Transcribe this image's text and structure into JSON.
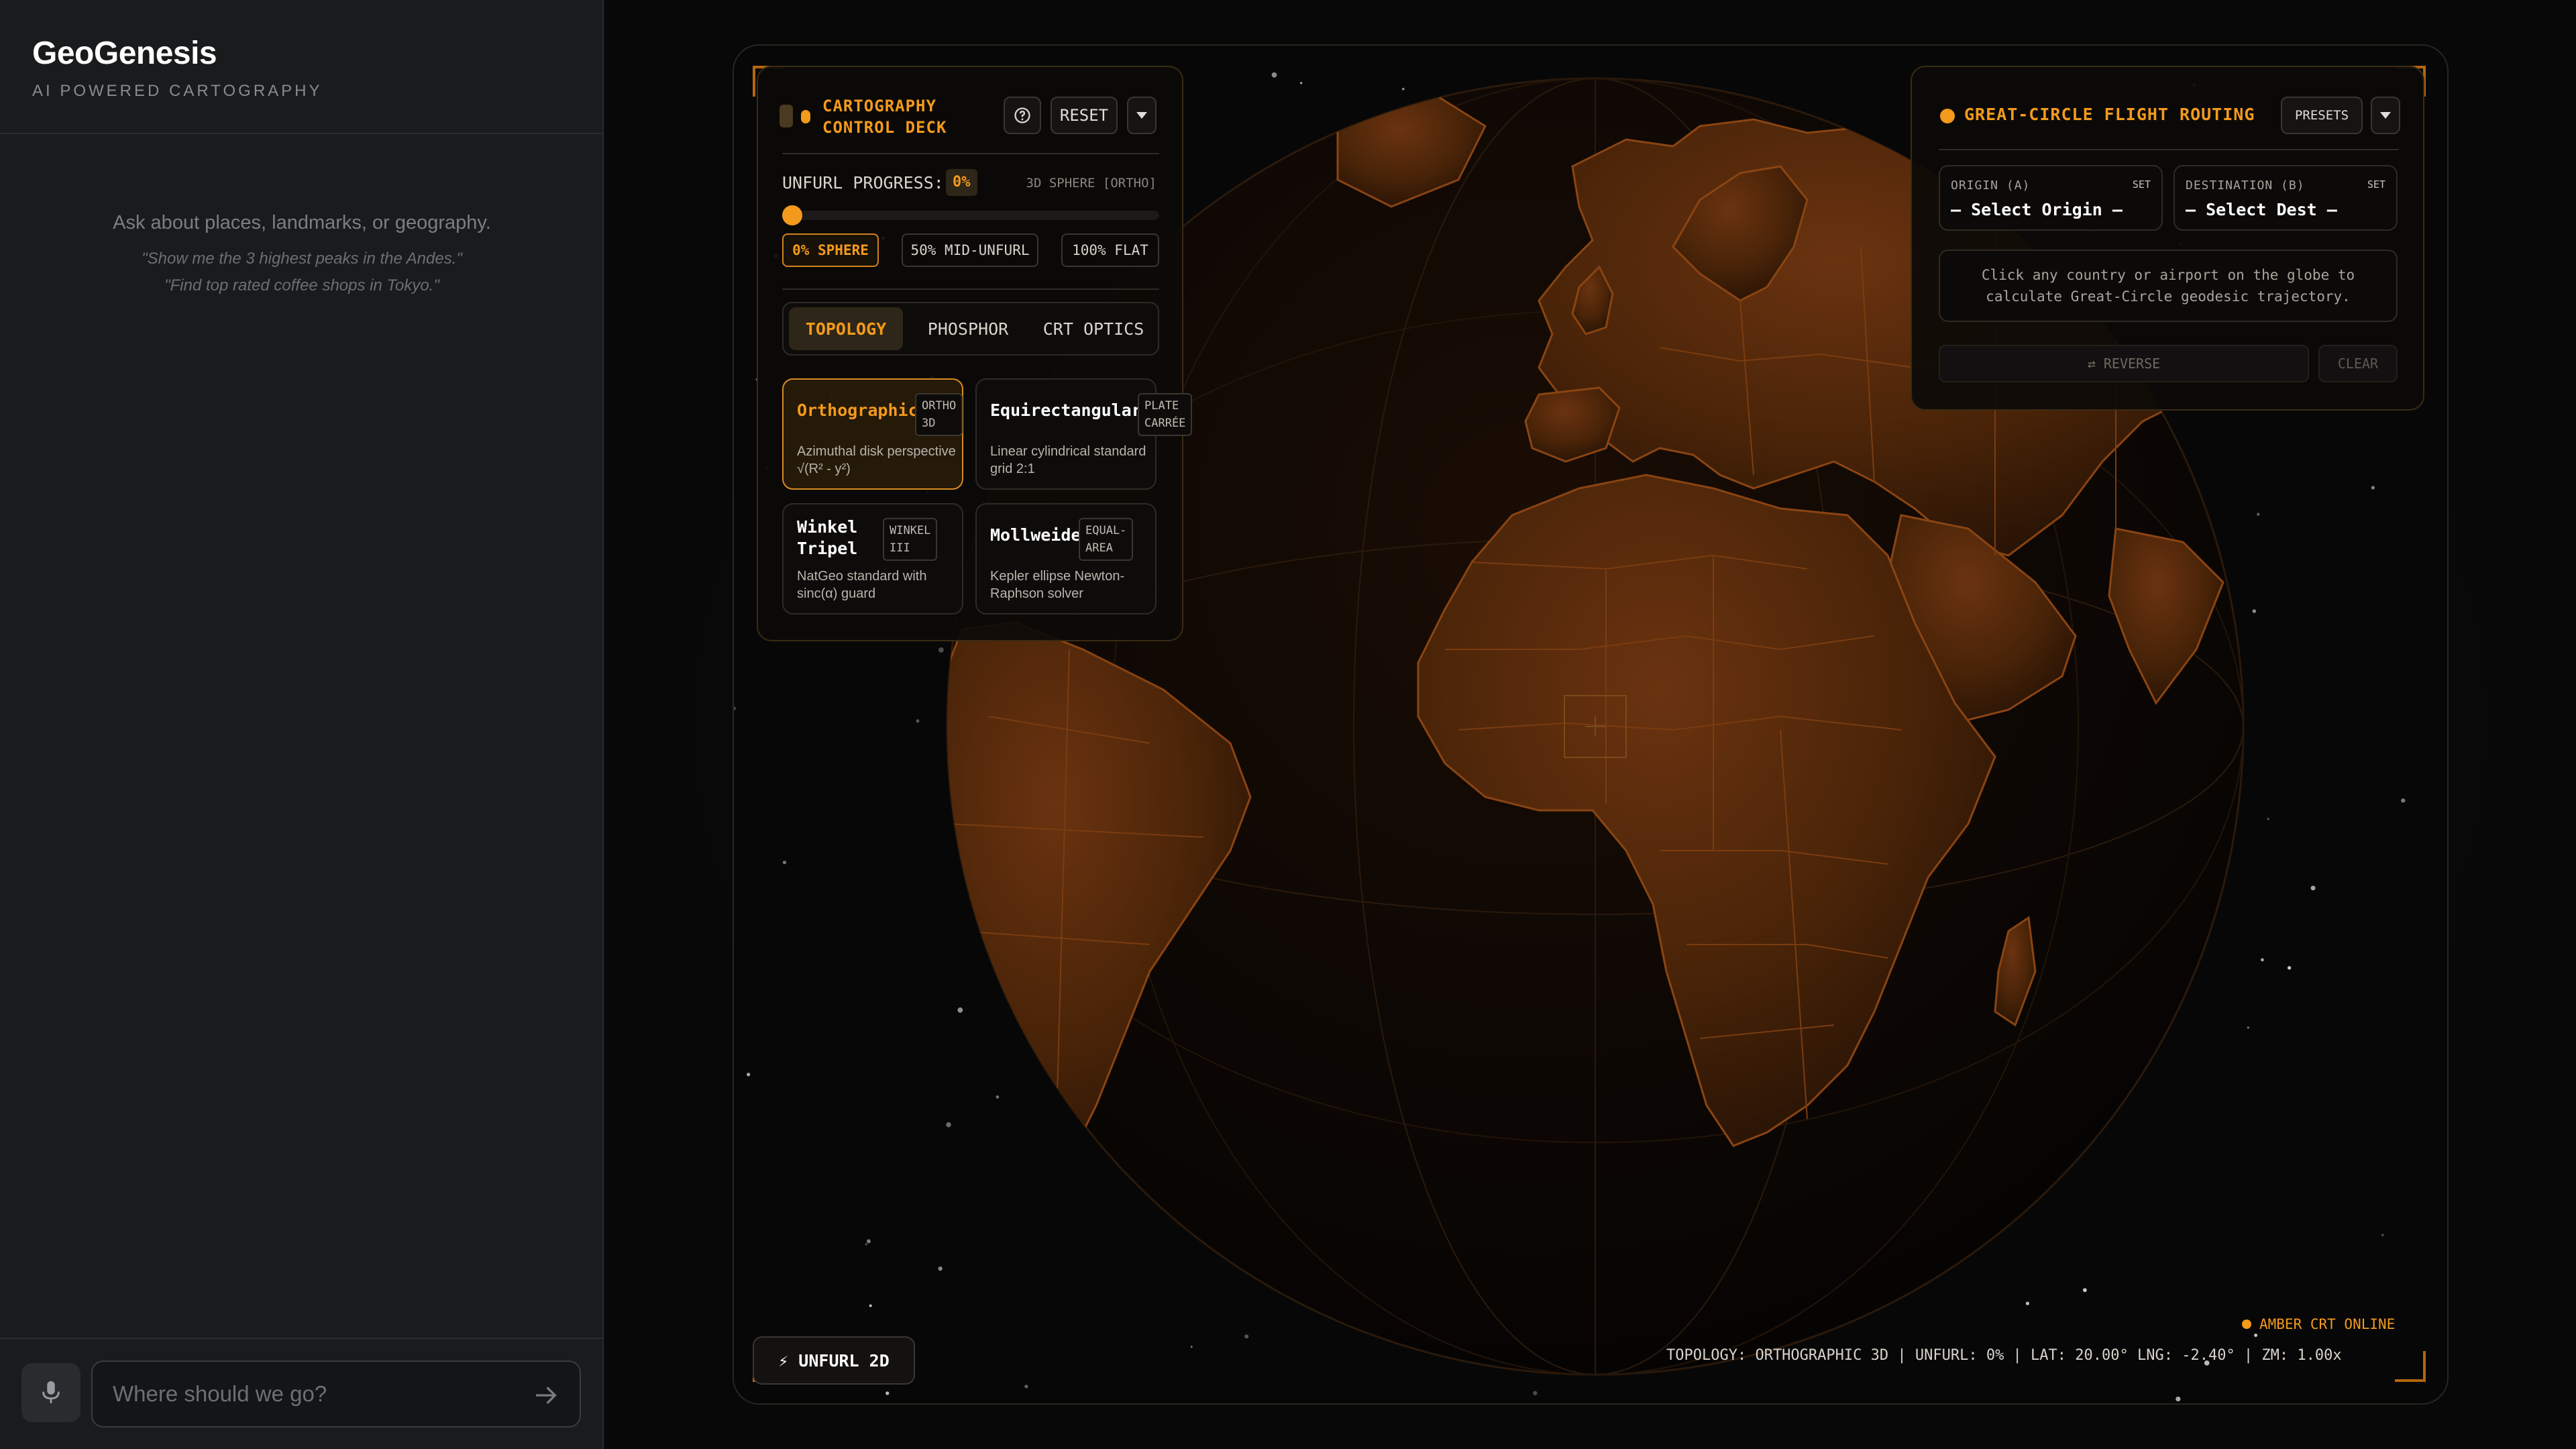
{
  "app": {
    "title": "GeoGenesis",
    "subtitle": "AI POWERED CARTOGRAPHY"
  },
  "sidebar": {
    "prompt": "Ask about places, landmarks, or geography.",
    "examples": [
      "\"Show me the 3 highest peaks in the Andes.\"",
      "\"Find top rated coffee shops in Tokyo.\""
    ],
    "chat": {
      "placeholder": "Where should we go?",
      "mic_icon": "microphone-icon",
      "send_icon": "arrow-right-icon"
    }
  },
  "control_deck": {
    "title_line1": "CARTOGRAPHY",
    "title_line2": "CONTROL DECK",
    "help_icon": "help-circle-icon",
    "reset_label": "RESET",
    "collapse_icon": "caret-down-icon",
    "unfurl_label": "UNFURL PROGRESS:",
    "unfurl_value": "0%",
    "unfurl_fraction": 0,
    "mode_label": "3D SPHERE [ORTHO]",
    "presets": [
      "0% SPHERE",
      "50% MID-UNFURL",
      "100% FLAT"
    ],
    "active_preset": 0,
    "tabs": [
      "TOPOLOGY",
      "PHOSPHOR",
      "CRT OPTICS"
    ],
    "active_tab": 0,
    "projections": [
      {
        "name": "Orthographic",
        "tag": [
          "ORTHO",
          "3D"
        ],
        "desc": "Azimuthal disk perspective √(R² - y²)",
        "active": true
      },
      {
        "name": "Equirectangular",
        "tag": [
          "PLATE",
          "CARRÉE"
        ],
        "desc": "Linear cylindrical standard grid 2:1",
        "active": false
      },
      {
        "name": "Winkel Tripel",
        "tag": [
          "WINKEL",
          "III"
        ],
        "desc": "NatGeo standard with sinc(α) guard",
        "active": false
      },
      {
        "name": "Mollweide",
        "tag": [
          "EQUAL-",
          "AREA"
        ],
        "desc": "Kepler ellipse Newton-Raphson solver",
        "active": false
      }
    ]
  },
  "flight_routing": {
    "title": "GREAT-CIRCLE FLIGHT ROUTING",
    "presets_label": "PRESETS",
    "collapse_icon": "caret-down-icon",
    "origin_label": "ORIGIN (A)",
    "origin_set": "SET",
    "origin_value": "— Select Origin —",
    "dest_label": "DESTINATION (B)",
    "dest_set": "SET",
    "dest_value": "— Select Dest —",
    "hint": "Click any country or airport on the globe to calculate Great-Circle geodesic trajectory.",
    "reverse_label": "⇄ REVERSE",
    "clear_label": "CLEAR"
  },
  "footer": {
    "unfurl_button": "⚡ UNFURL 2D",
    "crt_status": "AMBER CRT ONLINE",
    "status_line": "TOPOLOGY: ORTHOGRAPHIC 3D | UNFURL: 0% | LAT: 20.00° LNG: -2.40° | ZM: 1.00x"
  },
  "colors": {
    "accent": "#f39a1c",
    "land": "#4a2408",
    "land_border": "#8a4412",
    "ocean": "#0b0806",
    "panel_border": "#3a2b14"
  }
}
